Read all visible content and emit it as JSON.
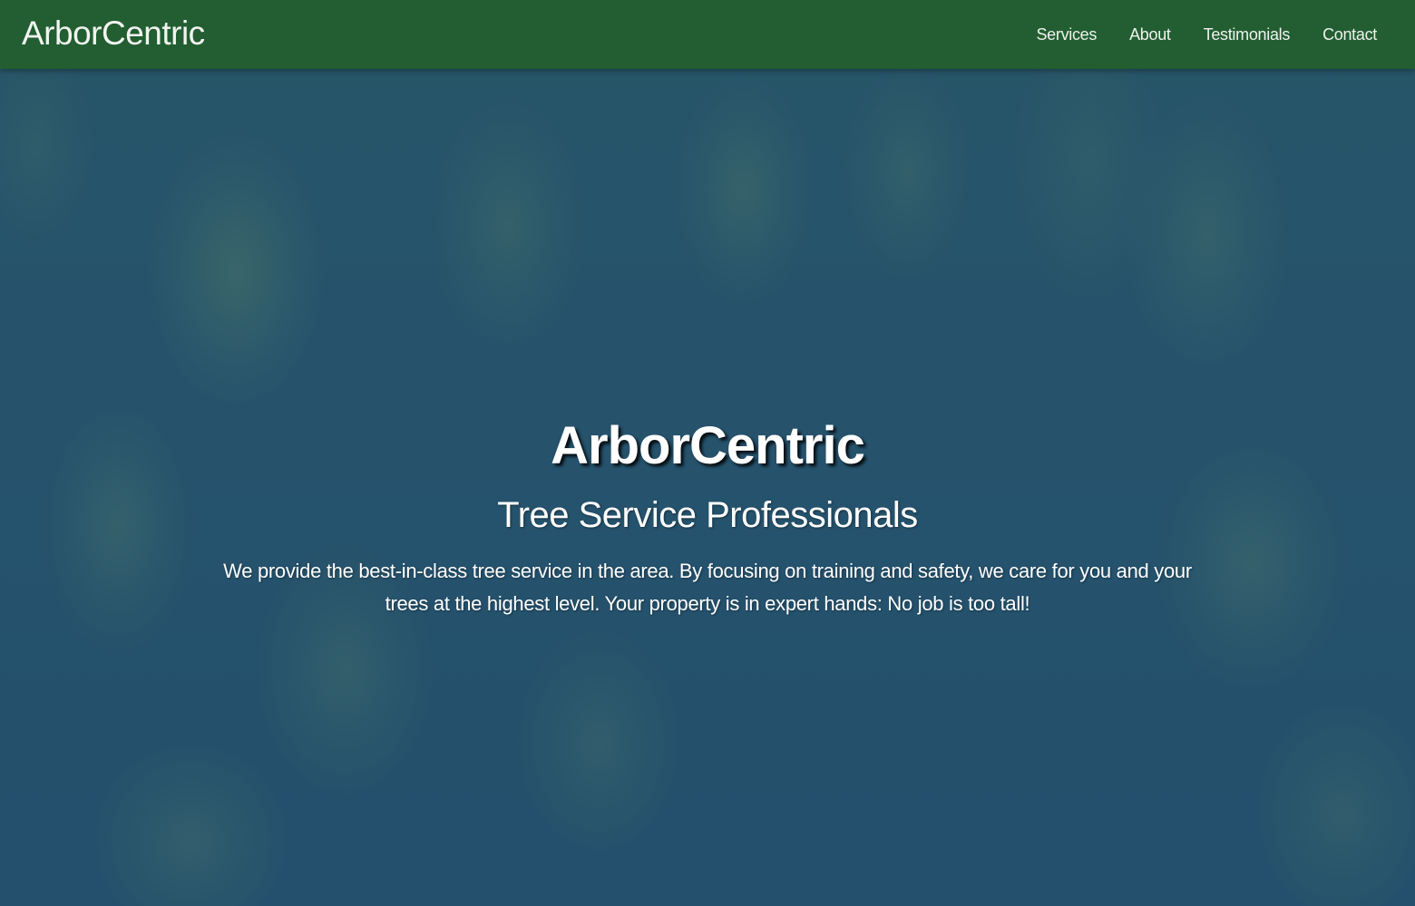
{
  "nav": {
    "brand": "ArborCentric",
    "links": [
      "Services",
      "About",
      "Testimonials",
      "Contact"
    ]
  },
  "hero": {
    "title": "ArborCentric",
    "subtitle": "Tree Service Professionals",
    "description": "We provide the best-in-class tree service in the area. By focusing on training and safety, we care for you and your trees at the highest level. Your property is in expert hands: No job is too tall!"
  },
  "colors": {
    "navbar": "#225e31",
    "hero_tint": "#2b5a70",
    "text": "#ffffff"
  }
}
